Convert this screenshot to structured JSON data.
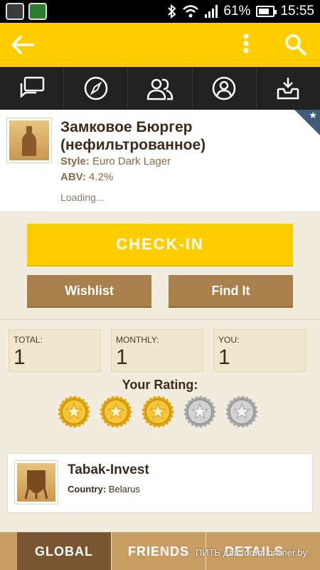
{
  "status_bar": {
    "battery": "61%",
    "time": "15:55"
  },
  "beer": {
    "name": "Замковое Бюргер (нефильтрованное)",
    "style_label": "Style:",
    "style": "Euro Dark Lager",
    "abv_label": "ABV:",
    "abv": "4.2%",
    "loading": "Loading..."
  },
  "actions": {
    "checkin": "CHECK-IN",
    "wishlist": "Wishlist",
    "find_it": "Find It"
  },
  "stats": [
    {
      "label": "TOTAL:",
      "value": "1"
    },
    {
      "label": "MONTHLY:",
      "value": "1"
    },
    {
      "label": "YOU:",
      "value": "1"
    }
  ],
  "rating": {
    "title": "Your Rating:",
    "value": 3,
    "max": 5
  },
  "brewery": {
    "name": "Tabak-Invest",
    "country_label": "Country:",
    "country": "Belarus"
  },
  "bottom_tabs": {
    "global": "GLOBAL",
    "friends": "FRIENDS",
    "details": "DETAILS"
  },
  "watermark": "ПИТЬ для forum.onliner.by",
  "colors": {
    "accent": "#ffcd00",
    "brown": "#a9804b",
    "dark": "#212121"
  }
}
